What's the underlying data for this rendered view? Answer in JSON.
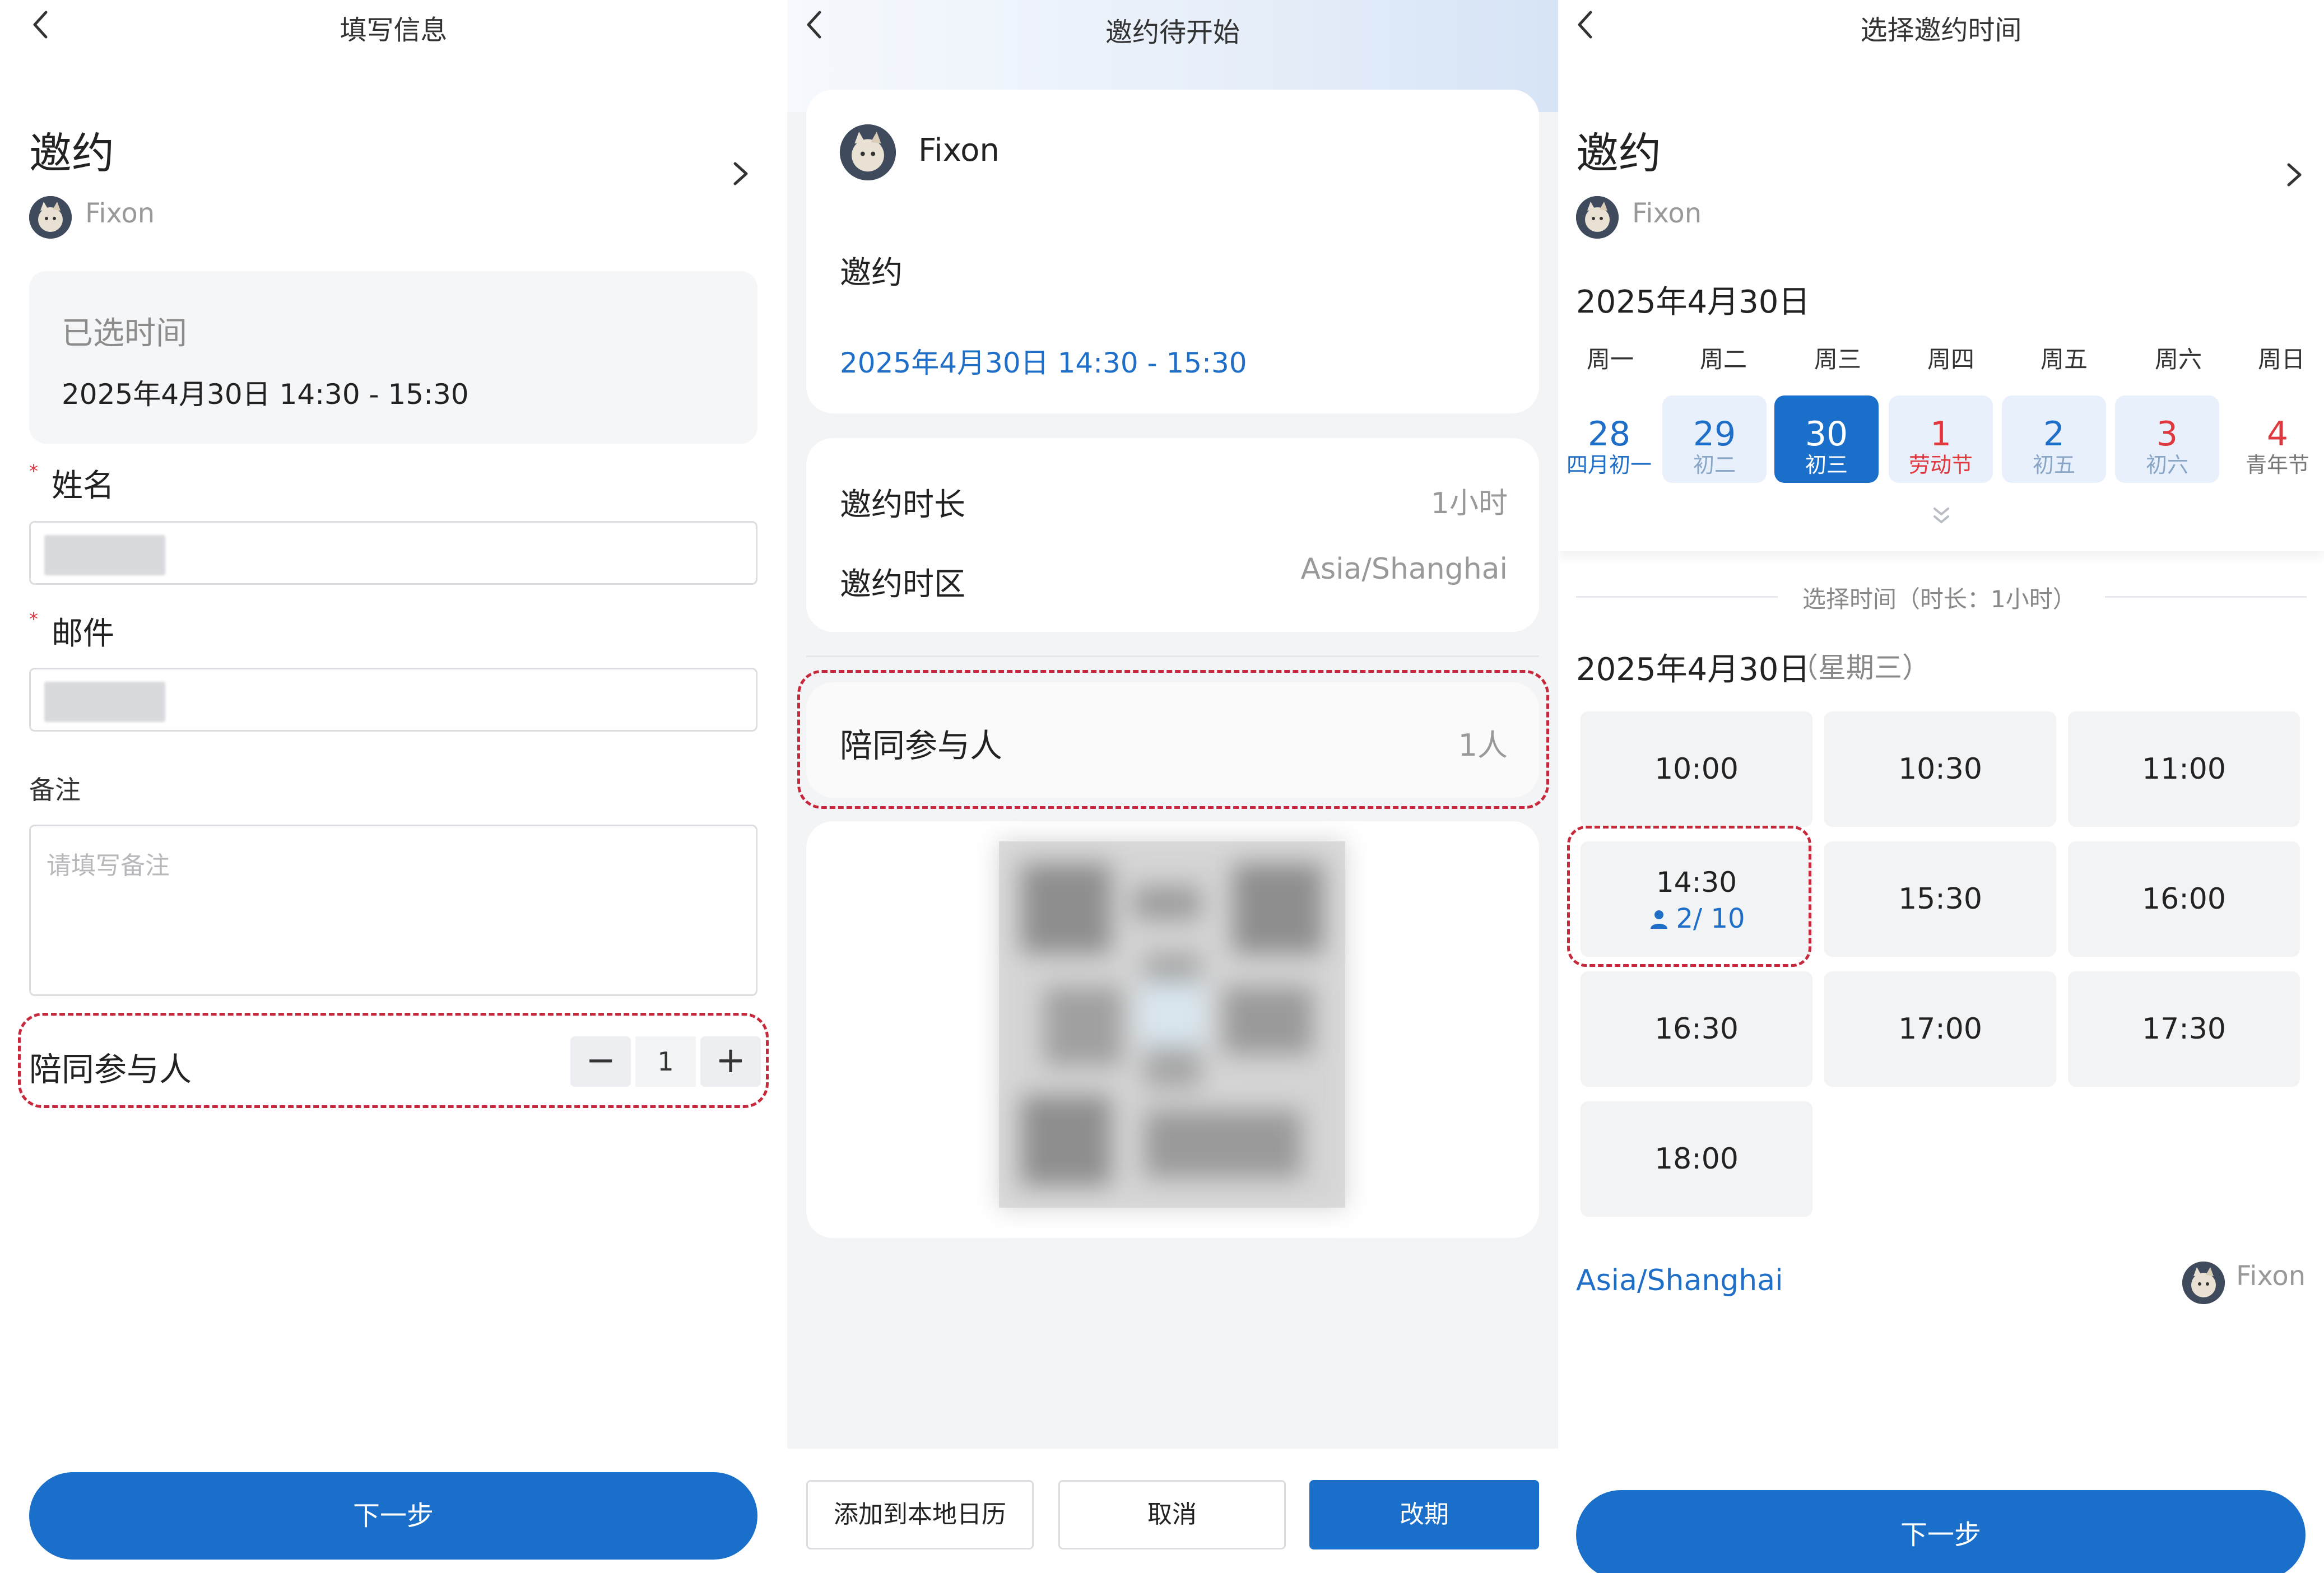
{
  "screen1": {
    "nav_title": "填写信息",
    "heading": "邀约",
    "host_name": "Fixon",
    "selected_label": "已选时间",
    "selected_value": "2025年4月30日 14:30 - 15:30",
    "name_label": "姓名",
    "email_label": "邮件",
    "required_mark": "*",
    "note_label": "备注",
    "note_placeholder": "请填写备注",
    "companions_label": "陪同参与人",
    "companions_value": "1",
    "minus": "−",
    "plus": "+",
    "next_button": "下一步"
  },
  "screen2": {
    "nav_title": "邀约待开始",
    "host_name": "Fixon",
    "event_title": "邀约",
    "event_time": "2025年4月30日 14:30 - 15:30",
    "duration_label": "邀约时长",
    "duration_value": "1小时",
    "timezone_label": "邀约时区",
    "timezone_value": "Asia/Shanghai",
    "companions_label": "陪同参与人",
    "companions_value": "1人",
    "add_calendar_button": "添加到本地日历",
    "cancel_button": "取消",
    "reschedule_button": "改期"
  },
  "screen3": {
    "nav_title": "选择邀约时间",
    "heading": "邀约",
    "host_name": "Fixon",
    "month_label": "2025年4月30日",
    "weekdays": [
      "周一",
      "周二",
      "周三",
      "周四",
      "周五",
      "周六",
      "周日"
    ],
    "days": [
      {
        "num": "28",
        "sub": "四月初一",
        "state": "plain"
      },
      {
        "num": "29",
        "sub": "初二",
        "state": "available"
      },
      {
        "num": "30",
        "sub": "初三",
        "state": "selected"
      },
      {
        "num": "1",
        "sub": "劳动节",
        "state": "holiday"
      },
      {
        "num": "2",
        "sub": "初五",
        "state": "available"
      },
      {
        "num": "3",
        "sub": "初六",
        "state": "available-weekend"
      },
      {
        "num": "4",
        "sub": "青年节",
        "state": "plain-weekend"
      }
    ],
    "duration_caption": "选择时间（时长：1小时）",
    "date_label": "2025年4月30日",
    "weekday_label": "（星期三）",
    "slots": [
      "10:00",
      "10:30",
      "11:00",
      "14:30",
      "15:30",
      "16:00",
      "16:30",
      "17:00",
      "17:30",
      "18:00"
    ],
    "slot_capacity": "2/ 10",
    "timezone": "Asia/Shanghai",
    "footer_host": "Fixon",
    "next_button": "下一步"
  },
  "colors": {
    "accent": "#1a6fcb",
    "holiday": "#e0383e",
    "annotation": "#c8283c"
  }
}
